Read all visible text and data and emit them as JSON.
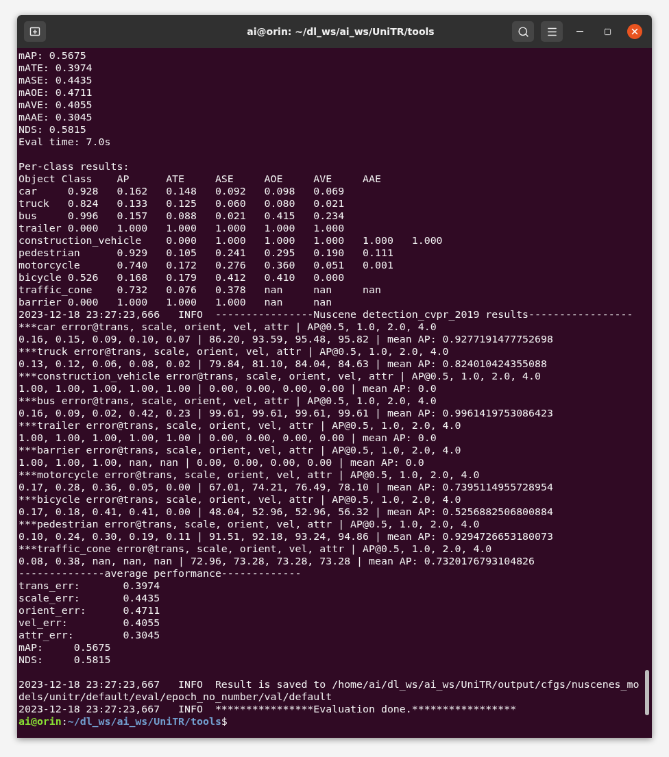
{
  "window": {
    "title": "ai@orin: ~/dl_ws/ai_ws/UniTR/tools"
  },
  "terminal": {
    "blocks": [
      [
        "mAP: 0.5675",
        "mATE: 0.3974",
        "mASE: 0.4435",
        "mAOE: 0.4711",
        "mAVE: 0.4055",
        "mAAE: 0.3045",
        "NDS: 0.5815",
        "Eval time: 7.0s"
      ],
      [
        "Per-class results:",
        "Object Class    AP      ATE     ASE     AOE     AVE     AAE",
        "car     0.928   0.162   0.148   0.092   0.098   0.069",
        "truck   0.824   0.133   0.125   0.060   0.080   0.021",
        "bus     0.996   0.157   0.088   0.021   0.415   0.234",
        "trailer 0.000   1.000   1.000   1.000   1.000   1.000",
        "construction_vehicle    0.000   1.000   1.000   1.000   1.000   1.000",
        "pedestrian      0.929   0.105   0.241   0.295   0.190   0.111",
        "motorcycle      0.740   0.172   0.276   0.360   0.051   0.001",
        "bicycle 0.526   0.168   0.179   0.412   0.410   0.000",
        "traffic_cone    0.732   0.076   0.378   nan     nan     nan",
        "barrier 0.000   1.000   1.000   1.000   nan     nan",
        "2023-12-18 23:27:23,666   INFO  ----------------Nuscene detection_cvpr_2019 results-----------------",
        "***car error@trans, scale, orient, vel, attr | AP@0.5, 1.0, 2.0, 4.0",
        "0.16, 0.15, 0.09, 0.10, 0.07 | 86.20, 93.59, 95.48, 95.82 | mean AP: 0.9277191477752698",
        "***truck error@trans, scale, orient, vel, attr | AP@0.5, 1.0, 2.0, 4.0",
        "0.13, 0.12, 0.06, 0.08, 0.02 | 79.84, 81.10, 84.04, 84.63 | mean AP: 0.824010424355088",
        "***construction_vehicle error@trans, scale, orient, vel, attr | AP@0.5, 1.0, 2.0, 4.0",
        "1.00, 1.00, 1.00, 1.00, 1.00 | 0.00, 0.00, 0.00, 0.00 | mean AP: 0.0",
        "***bus error@trans, scale, orient, vel, attr | AP@0.5, 1.0, 2.0, 4.0",
        "0.16, 0.09, 0.02, 0.42, 0.23 | 99.61, 99.61, 99.61, 99.61 | mean AP: 0.9961419753086423",
        "***trailer error@trans, scale, orient, vel, attr | AP@0.5, 1.0, 2.0, 4.0",
        "1.00, 1.00, 1.00, 1.00, 1.00 | 0.00, 0.00, 0.00, 0.00 | mean AP: 0.0",
        "***barrier error@trans, scale, orient, vel, attr | AP@0.5, 1.0, 2.0, 4.0",
        "1.00, 1.00, 1.00, nan, nan | 0.00, 0.00, 0.00, 0.00 | mean AP: 0.0",
        "***motorcycle error@trans, scale, orient, vel, attr | AP@0.5, 1.0, 2.0, 4.0",
        "0.17, 0.28, 0.36, 0.05, 0.00 | 67.01, 74.21, 76.49, 78.10 | mean AP: 0.7395114955728954",
        "***bicycle error@trans, scale, orient, vel, attr | AP@0.5, 1.0, 2.0, 4.0",
        "0.17, 0.18, 0.41, 0.41, 0.00 | 48.04, 52.96, 52.96, 56.32 | mean AP: 0.5256882506800884",
        "***pedestrian error@trans, scale, orient, vel, attr | AP@0.5, 1.0, 2.0, 4.0",
        "0.10, 0.24, 0.30, 0.19, 0.11 | 91.51, 92.18, 93.24, 94.86 | mean AP: 0.9294726653180073",
        "***traffic_cone error@trans, scale, orient, vel, attr | AP@0.5, 1.0, 2.0, 4.0",
        "0.08, 0.38, nan, nan, nan | 72.96, 73.28, 73.28, 73.28 | mean AP: 0.7320176793104826",
        "--------------average performance-------------",
        "trans_err:       0.3974",
        "scale_err:       0.4435",
        "orient_err:      0.4711",
        "vel_err:         0.4055",
        "attr_err:        0.3045",
        "mAP:     0.5675",
        "NDS:     0.5815"
      ],
      [
        "2023-12-18 23:27:23,667   INFO  Result is saved to /home/ai/dl_ws/ai_ws/UniTR/output/cfgs/nuscenes_mo",
        "dels/unitr/default/eval/epoch_no_number/val/default",
        "2023-12-18 23:27:23,667   INFO  ****************Evaluation done.*****************"
      ]
    ],
    "prompt": {
      "user_host": "ai@orin",
      "separator": ":",
      "path": "~/dl_ws/ai_ws/UniTR/tools",
      "symbol": "$"
    }
  }
}
